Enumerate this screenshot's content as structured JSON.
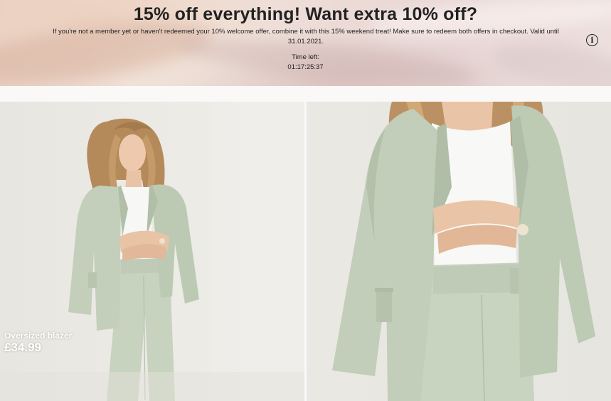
{
  "promo": {
    "title": "15% off everything! Want extra 10% off?",
    "text": "If you're not a member yet or haven't redeemed your 10% welcome offer, combine it with this 15% weekend treat! Make sure to redeem both offers in checkout. Valid until 31.01.2021.",
    "timer_label": "Time left:",
    "timer_value": "01:17:25:37",
    "info_icon": "info-icon",
    "info_glyph": "i"
  },
  "product": {
    "name": "Oversized blazer",
    "price": "£34.99"
  },
  "images": [
    {
      "description_icon": "model-photo",
      "view": "full-length"
    },
    {
      "description_icon": "model-photo",
      "view": "close-up"
    }
  ],
  "colors": {
    "blazer": "#c3cfba",
    "background": "#e9e7e2",
    "text": "#222222"
  }
}
